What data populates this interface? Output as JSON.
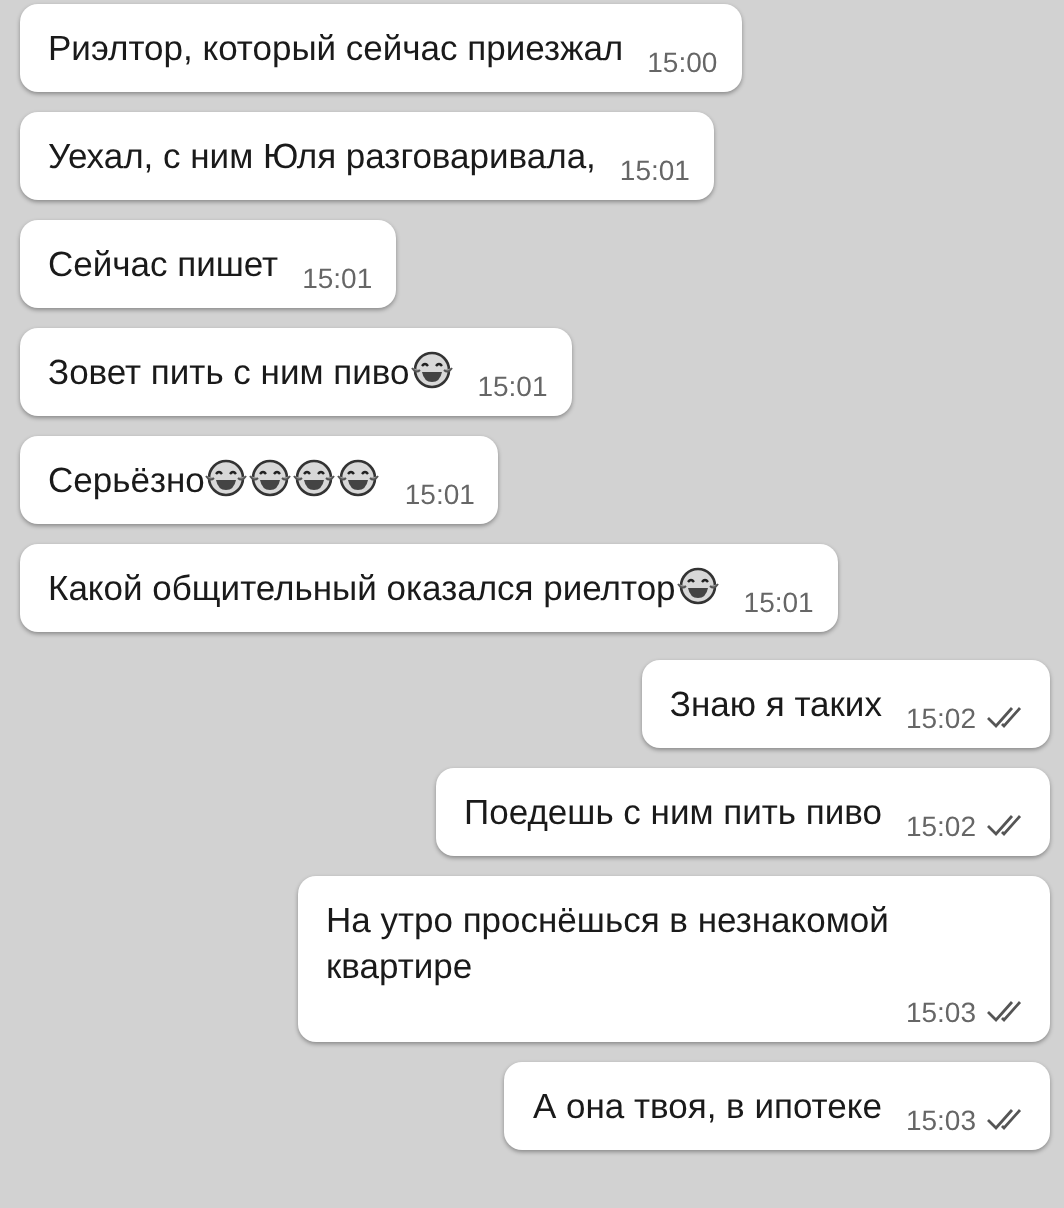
{
  "messages": [
    {
      "kind": "incoming",
      "text": "Риэлтор, который сейчас приезжал",
      "time": "15:00"
    },
    {
      "kind": "incoming",
      "text": "Уехал, с ним Юля разговаривала,",
      "time": "15:01"
    },
    {
      "kind": "incoming",
      "text": "Сейчас пишет",
      "time": "15:01"
    },
    {
      "kind": "incoming",
      "text": "Зовет пить с ним пиво",
      "emoji": [
        {
          "kind": "laugh"
        }
      ],
      "time": "15:01"
    },
    {
      "kind": "incoming",
      "text": "Серьёзно",
      "emoji": [
        {
          "kind": "laugh"
        },
        {
          "kind": "laugh"
        },
        {
          "kind": "laugh"
        },
        {
          "kind": "laugh"
        }
      ],
      "time": "15:01"
    },
    {
      "kind": "incoming",
      "text": "Какой общительный оказался риелтор",
      "emoji": [
        {
          "kind": "laugh"
        }
      ],
      "time": "15:01"
    },
    {
      "kind": "outgoing",
      "text": "Знаю я таких",
      "time": "15:02",
      "read": true
    },
    {
      "kind": "outgoing",
      "text": "Поедешь с ним пить пиво",
      "time": "15:02",
      "read": true
    },
    {
      "kind": "outgoing",
      "text": "На утро проснёшься в незнакомой квартире",
      "time": "15:03",
      "read": true
    },
    {
      "kind": "outgoing",
      "text": "А она твоя, в ипотеке",
      "time": "15:03",
      "read": true
    }
  ]
}
